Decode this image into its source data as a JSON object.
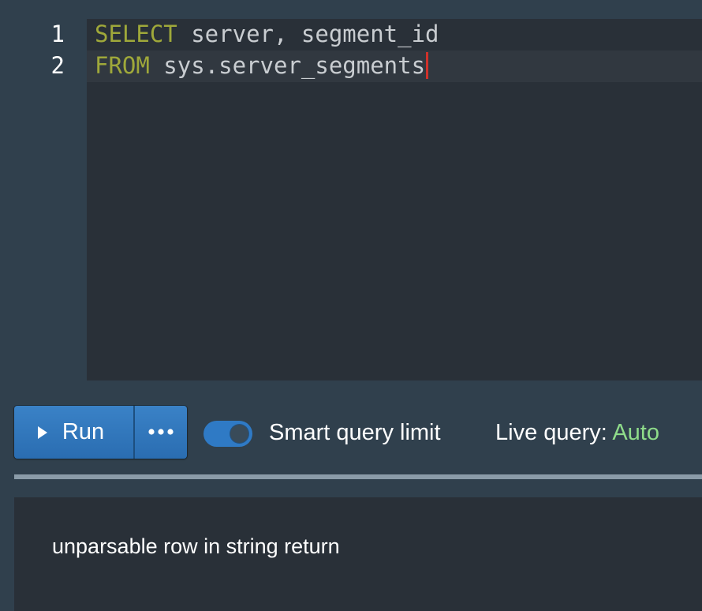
{
  "editor": {
    "line_numbers": [
      "1",
      "2"
    ],
    "lines": [
      {
        "keyword": "SELECT",
        "rest": " server, segment_id"
      },
      {
        "keyword": "FROM",
        "rest": " sys.server_segments"
      }
    ],
    "keyword_color": "#9fa83a",
    "cursor_color": "#d0312a"
  },
  "controls": {
    "run_label": "Run",
    "more_icon": "ellipsis-icon",
    "smart_query_limit": {
      "label": "Smart query limit",
      "enabled": true
    },
    "live_query": {
      "label": "Live query:",
      "value": "Auto",
      "value_color": "#8fdc8a"
    }
  },
  "output": {
    "message": "unparsable row in string return"
  },
  "colors": {
    "accent": "#2f7ac5",
    "background": "#30404d",
    "panel": "#293038"
  }
}
